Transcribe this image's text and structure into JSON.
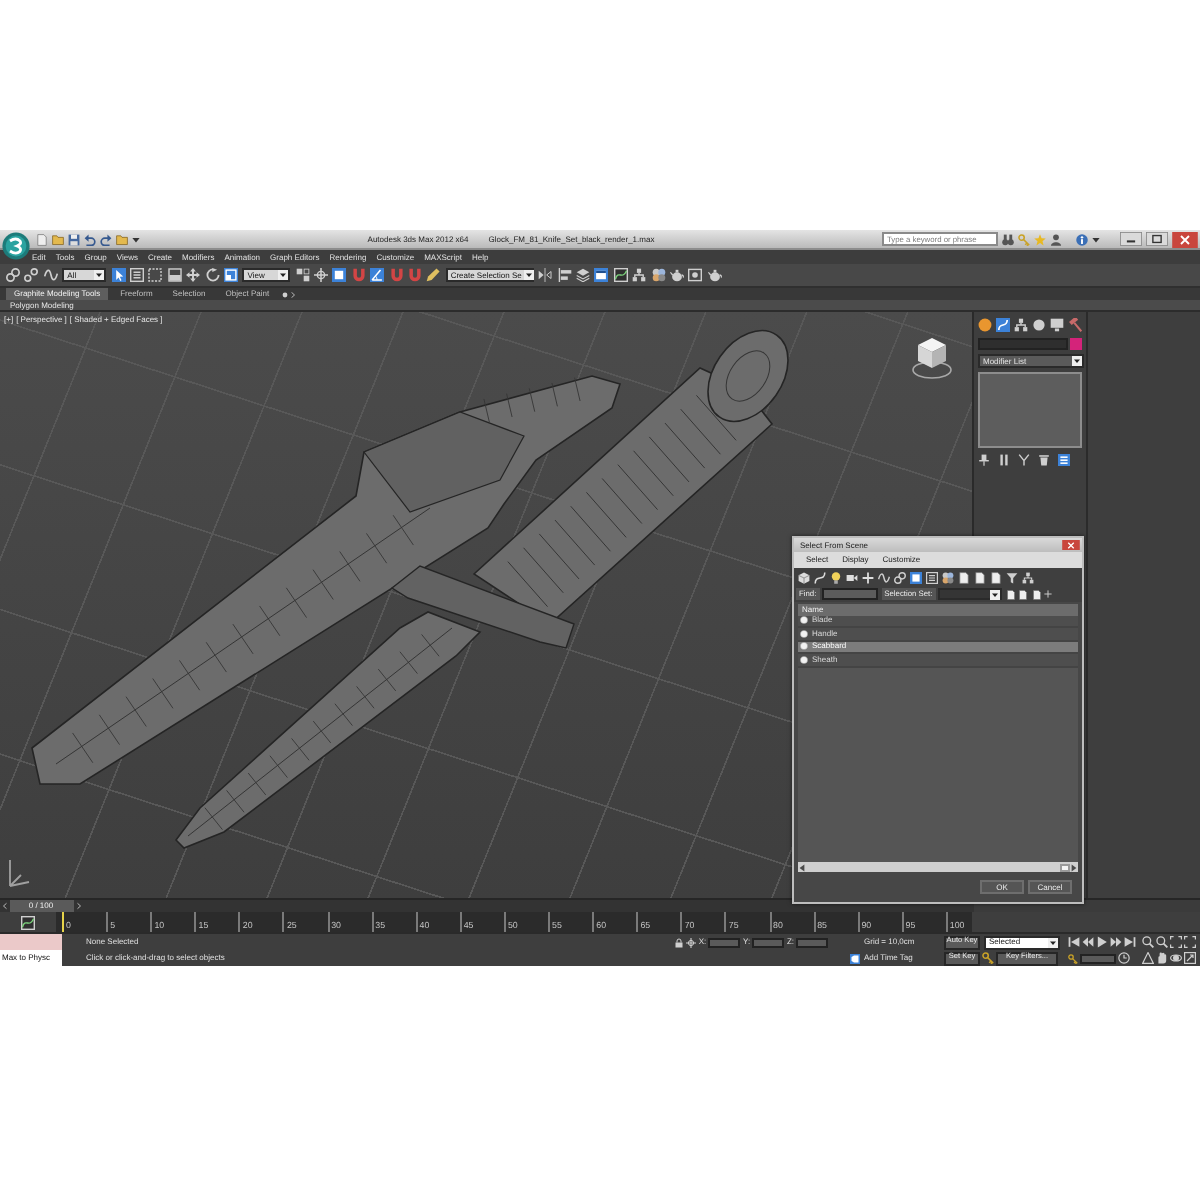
{
  "window": {
    "title": "Autodesk 3ds Max 2012 x64",
    "file": "Glock_FM_81_Knife_Set_black_render_1.max"
  },
  "search": {
    "placeholder": "Type a keyword or phrase"
  },
  "menu": [
    "Edit",
    "Tools",
    "Group",
    "Views",
    "Create",
    "Modifiers",
    "Animation",
    "Graph Editors",
    "Rendering",
    "Customize",
    "MAXScript",
    "Help"
  ],
  "toolbar": {
    "selection_filter": "All",
    "reference_coordinate_system": "View",
    "named_selection_set": "Create Selection Se"
  },
  "ribbon": {
    "tabs": [
      {
        "label": "Graphite Modeling Tools",
        "selected": true
      },
      {
        "label": "Freeform",
        "selected": false
      },
      {
        "label": "Selection",
        "selected": false
      },
      {
        "label": "Object Paint",
        "selected": false
      }
    ],
    "panel": "Polygon Modeling"
  },
  "viewport": {
    "labels": [
      "[+]",
      "[ Perspective ]",
      "[ Shaded + Edged Faces ]"
    ]
  },
  "command_panel": {
    "modifier_list": "Modifier List"
  },
  "dialog": {
    "title": "Select From Scene",
    "menu": [
      "Select",
      "Display",
      "Customize"
    ],
    "find_label": "Find:",
    "selection_set_label": "Selection Set:",
    "column": "Name",
    "rows": [
      {
        "name": "Blade",
        "selected": false
      },
      {
        "name": "Handle",
        "selected": false
      },
      {
        "name": "Scabbard",
        "selected": true
      },
      {
        "name": "Sheath",
        "selected": false
      }
    ],
    "buttons": [
      "OK",
      "Cancel"
    ]
  },
  "time_slider": {
    "label": "0 / 100"
  },
  "track_bar": {
    "ticks": [
      "0",
      "5",
      "10",
      "15",
      "20",
      "25",
      "30",
      "35",
      "40",
      "45",
      "50",
      "55",
      "60",
      "65",
      "70",
      "75",
      "80",
      "85",
      "90",
      "95",
      "100"
    ]
  },
  "status_bar": {
    "listener_input": "Max to Physc",
    "selection": "None Selected",
    "prompt": "Click or click-and-drag to select objects",
    "coordinates": [
      "X:",
      "Y:",
      "Z:"
    ],
    "grid": "Grid = 10,0cm",
    "time_tag": "Add Time Tag",
    "auto_key": "Auto Key",
    "key_mode": "Selected",
    "set_key": "Set Key",
    "key_filters": "Key Filters..."
  }
}
